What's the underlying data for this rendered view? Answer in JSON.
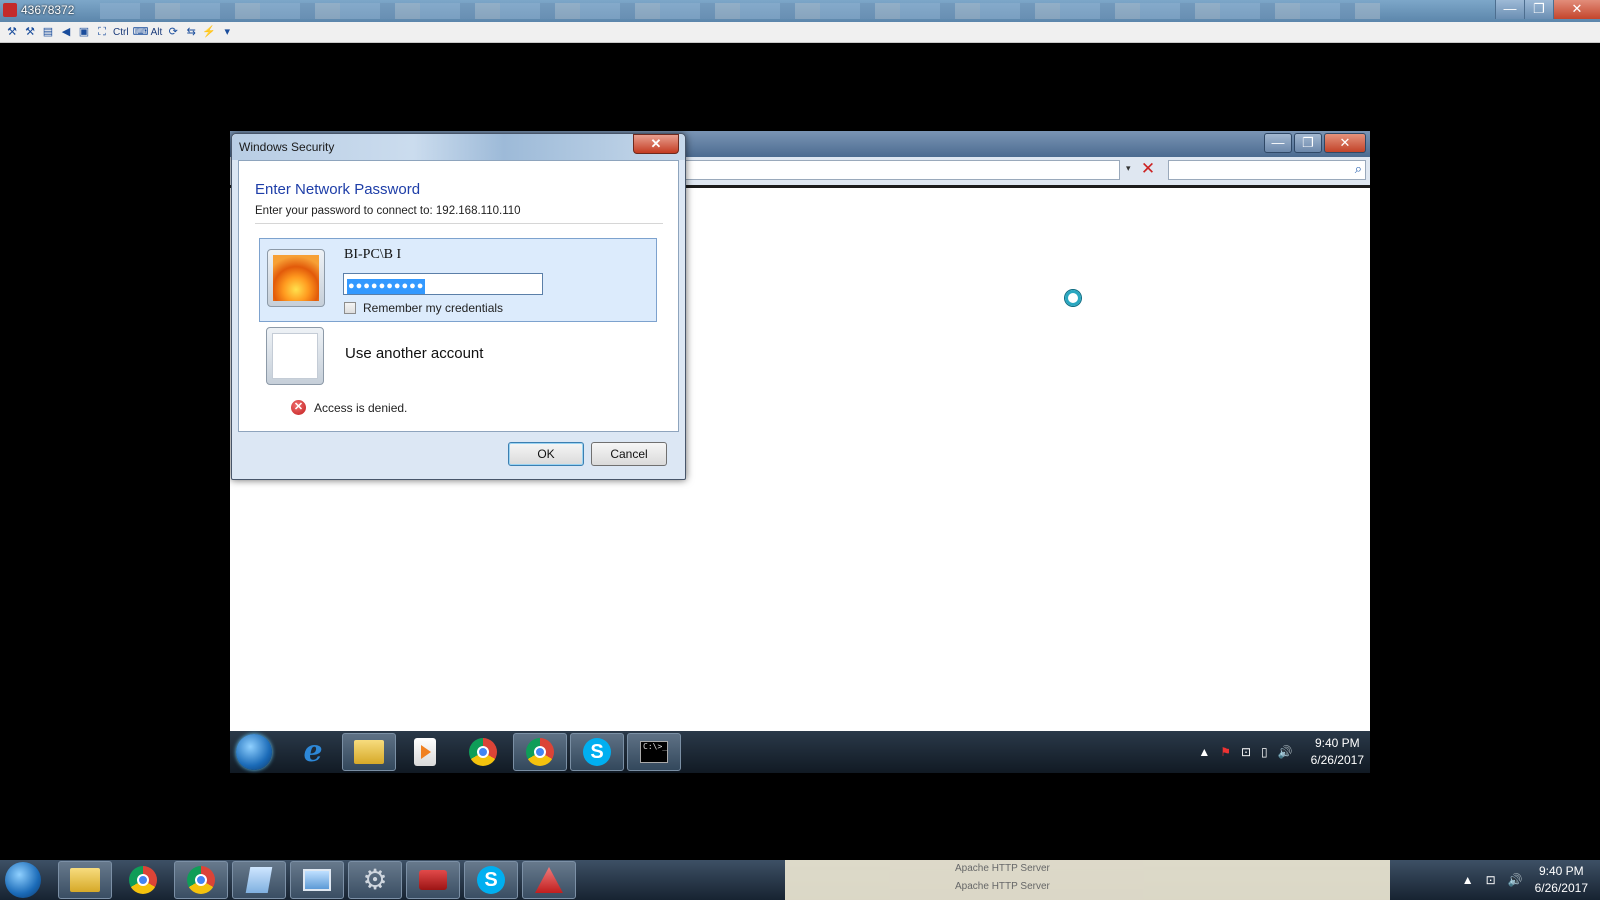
{
  "viewer": {
    "title": "43678372",
    "toolbar": {
      "ctrl_label": "Ctrl",
      "alt_label": "Alt"
    },
    "window_buttons": {
      "minimize": "—",
      "maximize": "❐",
      "close": "✕"
    }
  },
  "browser": {
    "window_buttons": {
      "minimize": "—",
      "maximize": "❐",
      "close": "✕"
    },
    "stop_glyph": "✕",
    "dropdown_glyph": "▾",
    "search_glyph": "⌕"
  },
  "dialog": {
    "title": "Windows Security",
    "close_glyph": "✕",
    "heading": "Enter Network Password",
    "subtitle": "Enter your password to connect to: 192.168.110.110",
    "credential": {
      "username": "BI-PC\\B I",
      "password_mask": "●●●●●●●●●●",
      "remember_label": "Remember my credentials",
      "remember_checked": false
    },
    "other_account_label": "Use another account",
    "error_glyph": "✕",
    "error_text": "Access is denied.",
    "ok_label": "OK",
    "cancel_label": "Cancel"
  },
  "remote_taskbar": {
    "ie_glyph": "e",
    "skype_glyph": "S",
    "cmd_glyph": "C:\\>_",
    "tray": {
      "show_hidden": "▲",
      "flag": "⚑",
      "network": "⊡",
      "power": "▯",
      "volume": "🔊"
    },
    "clock_time": "9:40 PM",
    "clock_date": "6/26/2017"
  },
  "host_taskbar": {
    "skype_glyph": "S",
    "gear_glyph": "⚙",
    "preview_lines": [
      "Apache HTTP Server",
      "Apache HTTP Server"
    ],
    "tray": {
      "show_hidden": "▲",
      "network": "⊡",
      "volume": "🔊"
    },
    "clock_time": "9:40 PM",
    "clock_date": "6/26/2017"
  },
  "colors": {
    "heading_blue": "#1e3ea8",
    "tile_selected": "#dcebfc",
    "close_red": "#c43c22",
    "selection_blue": "#3399ff"
  }
}
